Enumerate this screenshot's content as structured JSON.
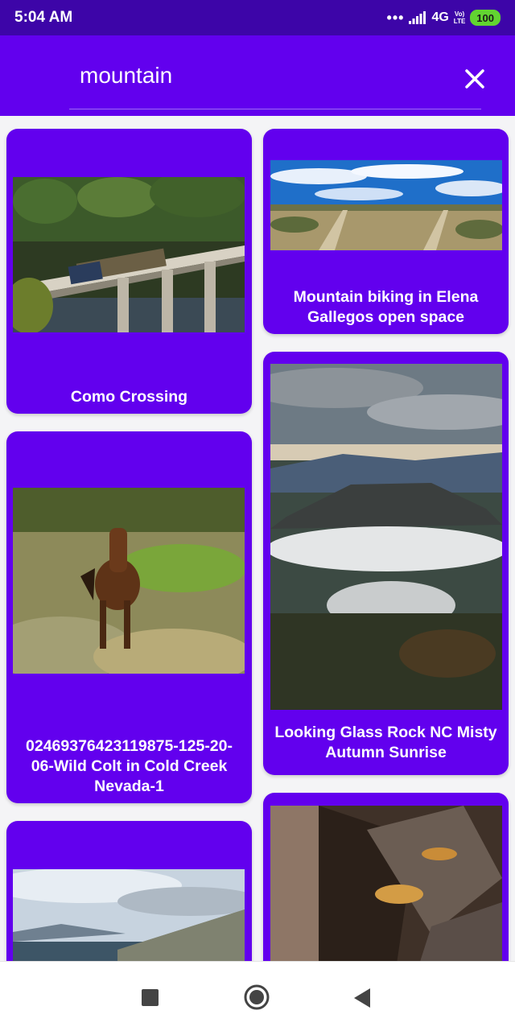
{
  "status_bar": {
    "time": "5:04 AM",
    "dots": "•••",
    "network": "4G",
    "volte_top": "Vo)",
    "volte_bottom": "LTE",
    "battery": "100"
  },
  "search": {
    "query": "mountain",
    "close_icon": "close-icon"
  },
  "results": [
    {
      "title": "Como Crossing",
      "image": "train-bridge-photo"
    },
    {
      "title": "Mountain biking in Elena Gallegos open space",
      "image": "desert-trail-photo"
    },
    {
      "title": "02469376423119875-125-20-06-Wild Colt in Cold Creek Nevada-1",
      "image": "wild-colt-photo"
    },
    {
      "title": "Looking Glass Rock NC Misty Autumn Sunrise",
      "image": "misty-mountain-photo"
    },
    {
      "title": "",
      "image": "mountain-lake-photo"
    },
    {
      "title": "",
      "image": "amber-crystal-photo"
    }
  ],
  "nav_bar": {
    "recent_icon": "square-icon",
    "home_icon": "circle-icon",
    "back_icon": "triangle-back-icon"
  },
  "colors": {
    "status_bar": "#3d05a8",
    "primary": "#6200ee",
    "background": "#f4f4f6"
  }
}
